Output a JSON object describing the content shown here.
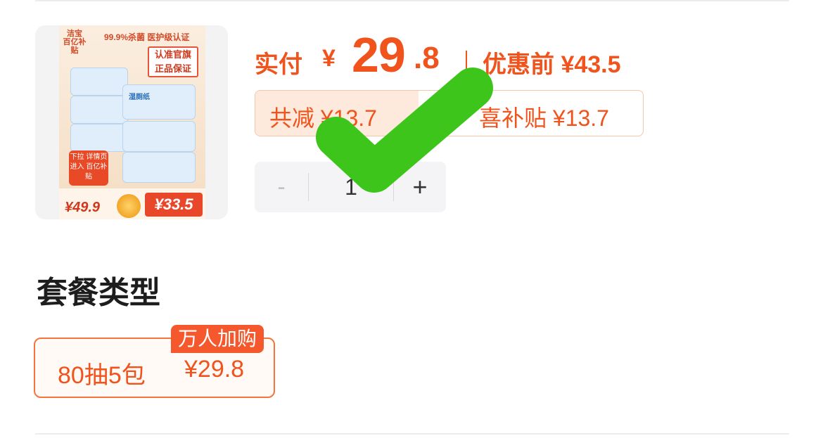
{
  "product": {
    "thumbnail": {
      "brand": "洁宝 百亿补贴",
      "claim": "99.9%杀菌 医护级认证",
      "badge_line1": "认准官旗",
      "badge_line2": "正品保证",
      "pack_label": "湿厕纸",
      "promo": "下拉 详情页进入 百亿补贴",
      "old_price": "¥49.9",
      "new_price": "¥33.5"
    }
  },
  "price": {
    "label": "实付",
    "currency": "¥",
    "integer": "29",
    "decimal": ".8",
    "before_label": "优惠前 ¥43.5"
  },
  "discount": {
    "total": "共减 ¥13.7",
    "subsidy": "喜补贴 ¥13.7"
  },
  "quantity": {
    "minus": "-",
    "value": "1",
    "plus": "+"
  },
  "package": {
    "section_title": "套餐类型",
    "options": [
      {
        "name": "80抽5包",
        "price": "¥29.8",
        "tag": "万人加购"
      }
    ]
  },
  "colors": {
    "accent": "#f0531c",
    "check": "#3ec51c",
    "stepper_bg": "#f4f4f6"
  },
  "icons": {
    "overlay": "checkmark-icon"
  }
}
